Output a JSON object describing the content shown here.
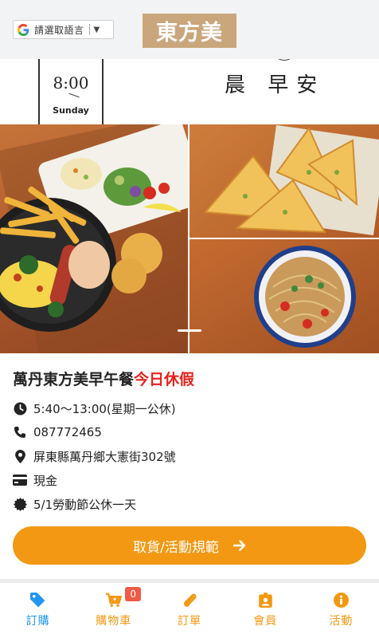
{
  "header": {
    "language_selector": {
      "label": "請選取語言",
      "arrow": "▼",
      "icon": "google-g-icon"
    },
    "brand_logo_text": "東方美"
  },
  "banner": {
    "clock_time": "8:00",
    "clock_day": "Sunday",
    "morning_text": "晨 早安",
    "slide_count_visible": 1
  },
  "store": {
    "name": "萬丹東方美早午餐",
    "status": "今日休假",
    "hours": "5:40～13:00(星期一公休)",
    "phone": "087772465",
    "address": "屏東縣萬丹鄉大憲街302號",
    "payment": "現金",
    "notice": "5/1勞動節公休一天"
  },
  "cta": {
    "label": "取貨/活動規範",
    "icon": "arrow-right-icon"
  },
  "bottom_nav": {
    "items": [
      {
        "label": "訂購",
        "icon": "tag-icon"
      },
      {
        "label": "購物車",
        "icon": "cart-icon",
        "badge": "0"
      },
      {
        "label": "訂單",
        "icon": "paperclip-icon"
      },
      {
        "label": "會員",
        "icon": "id-badge-icon"
      },
      {
        "label": "活動",
        "icon": "info-circle-icon"
      }
    ]
  },
  "colors": {
    "accent": "#f39812",
    "active_nav": "#2196f3",
    "status_red": "#e8211c",
    "brand_logo_bg": "#c9a67b",
    "badge": "#f05a47"
  }
}
